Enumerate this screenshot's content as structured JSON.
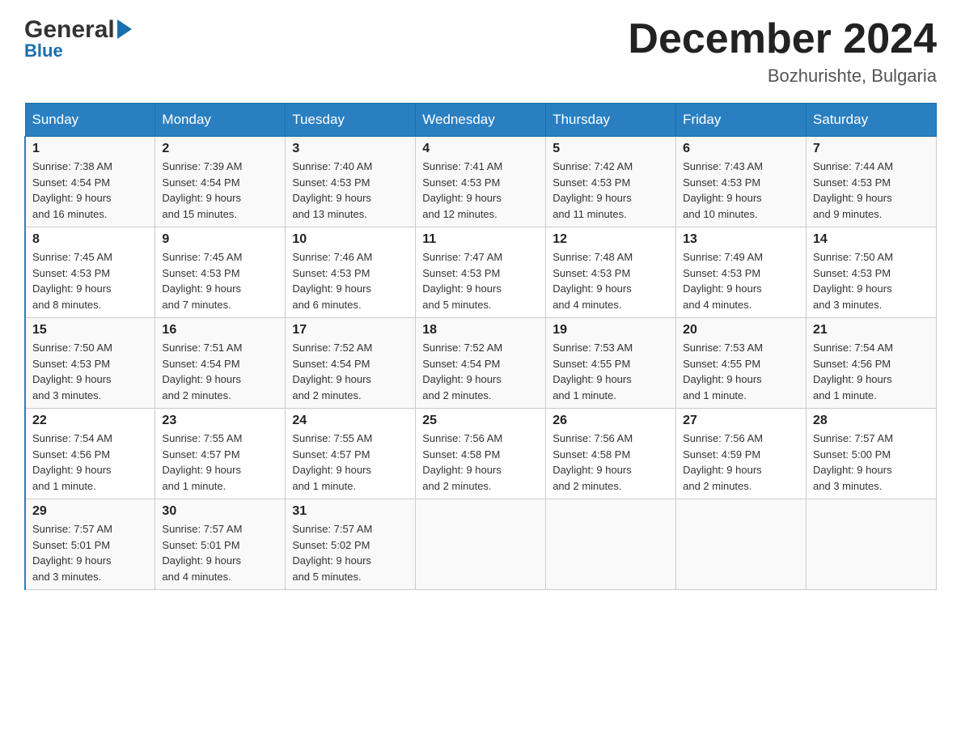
{
  "header": {
    "logo_general": "General",
    "logo_blue": "Blue",
    "month_title": "December 2024",
    "location": "Bozhurishte, Bulgaria"
  },
  "weekdays": [
    "Sunday",
    "Monday",
    "Tuesday",
    "Wednesday",
    "Thursday",
    "Friday",
    "Saturday"
  ],
  "weeks": [
    [
      {
        "day": "1",
        "sunrise": "7:38 AM",
        "sunset": "4:54 PM",
        "daylight": "9 hours and 16 minutes."
      },
      {
        "day": "2",
        "sunrise": "7:39 AM",
        "sunset": "4:54 PM",
        "daylight": "9 hours and 15 minutes."
      },
      {
        "day": "3",
        "sunrise": "7:40 AM",
        "sunset": "4:53 PM",
        "daylight": "9 hours and 13 minutes."
      },
      {
        "day": "4",
        "sunrise": "7:41 AM",
        "sunset": "4:53 PM",
        "daylight": "9 hours and 12 minutes."
      },
      {
        "day": "5",
        "sunrise": "7:42 AM",
        "sunset": "4:53 PM",
        "daylight": "9 hours and 11 minutes."
      },
      {
        "day": "6",
        "sunrise": "7:43 AM",
        "sunset": "4:53 PM",
        "daylight": "9 hours and 10 minutes."
      },
      {
        "day": "7",
        "sunrise": "7:44 AM",
        "sunset": "4:53 PM",
        "daylight": "9 hours and 9 minutes."
      }
    ],
    [
      {
        "day": "8",
        "sunrise": "7:45 AM",
        "sunset": "4:53 PM",
        "daylight": "9 hours and 8 minutes."
      },
      {
        "day": "9",
        "sunrise": "7:45 AM",
        "sunset": "4:53 PM",
        "daylight": "9 hours and 7 minutes."
      },
      {
        "day": "10",
        "sunrise": "7:46 AM",
        "sunset": "4:53 PM",
        "daylight": "9 hours and 6 minutes."
      },
      {
        "day": "11",
        "sunrise": "7:47 AM",
        "sunset": "4:53 PM",
        "daylight": "9 hours and 5 minutes."
      },
      {
        "day": "12",
        "sunrise": "7:48 AM",
        "sunset": "4:53 PM",
        "daylight": "9 hours and 4 minutes."
      },
      {
        "day": "13",
        "sunrise": "7:49 AM",
        "sunset": "4:53 PM",
        "daylight": "9 hours and 4 minutes."
      },
      {
        "day": "14",
        "sunrise": "7:50 AM",
        "sunset": "4:53 PM",
        "daylight": "9 hours and 3 minutes."
      }
    ],
    [
      {
        "day": "15",
        "sunrise": "7:50 AM",
        "sunset": "4:53 PM",
        "daylight": "9 hours and 3 minutes."
      },
      {
        "day": "16",
        "sunrise": "7:51 AM",
        "sunset": "4:54 PM",
        "daylight": "9 hours and 2 minutes."
      },
      {
        "day": "17",
        "sunrise": "7:52 AM",
        "sunset": "4:54 PM",
        "daylight": "9 hours and 2 minutes."
      },
      {
        "day": "18",
        "sunrise": "7:52 AM",
        "sunset": "4:54 PM",
        "daylight": "9 hours and 2 minutes."
      },
      {
        "day": "19",
        "sunrise": "7:53 AM",
        "sunset": "4:55 PM",
        "daylight": "9 hours and 1 minute."
      },
      {
        "day": "20",
        "sunrise": "7:53 AM",
        "sunset": "4:55 PM",
        "daylight": "9 hours and 1 minute."
      },
      {
        "day": "21",
        "sunrise": "7:54 AM",
        "sunset": "4:56 PM",
        "daylight": "9 hours and 1 minute."
      }
    ],
    [
      {
        "day": "22",
        "sunrise": "7:54 AM",
        "sunset": "4:56 PM",
        "daylight": "9 hours and 1 minute."
      },
      {
        "day": "23",
        "sunrise": "7:55 AM",
        "sunset": "4:57 PM",
        "daylight": "9 hours and 1 minute."
      },
      {
        "day": "24",
        "sunrise": "7:55 AM",
        "sunset": "4:57 PM",
        "daylight": "9 hours and 1 minute."
      },
      {
        "day": "25",
        "sunrise": "7:56 AM",
        "sunset": "4:58 PM",
        "daylight": "9 hours and 2 minutes."
      },
      {
        "day": "26",
        "sunrise": "7:56 AM",
        "sunset": "4:58 PM",
        "daylight": "9 hours and 2 minutes."
      },
      {
        "day": "27",
        "sunrise": "7:56 AM",
        "sunset": "4:59 PM",
        "daylight": "9 hours and 2 minutes."
      },
      {
        "day": "28",
        "sunrise": "7:57 AM",
        "sunset": "5:00 PM",
        "daylight": "9 hours and 3 minutes."
      }
    ],
    [
      {
        "day": "29",
        "sunrise": "7:57 AM",
        "sunset": "5:01 PM",
        "daylight": "9 hours and 3 minutes."
      },
      {
        "day": "30",
        "sunrise": "7:57 AM",
        "sunset": "5:01 PM",
        "daylight": "9 hours and 4 minutes."
      },
      {
        "day": "31",
        "sunrise": "7:57 AM",
        "sunset": "5:02 PM",
        "daylight": "9 hours and 5 minutes."
      },
      null,
      null,
      null,
      null
    ]
  ],
  "labels": {
    "sunrise": "Sunrise:",
    "sunset": "Sunset:",
    "daylight": "Daylight:"
  }
}
